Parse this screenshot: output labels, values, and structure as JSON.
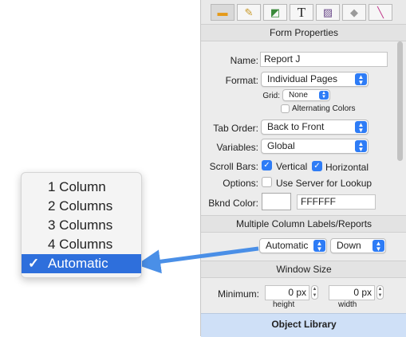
{
  "toolbar": {
    "tools": [
      {
        "icon": "field-tool-icon",
        "glyph": "▬",
        "active": true
      },
      {
        "icon": "pencil-icon",
        "glyph": "✎"
      },
      {
        "icon": "shapes-icon",
        "glyph": "◩"
      },
      {
        "icon": "text-tool-icon",
        "glyph": "T"
      },
      {
        "icon": "picture-icon",
        "glyph": "▨"
      },
      {
        "icon": "diamond-icon",
        "glyph": "◆"
      },
      {
        "icon": "line-tool-icon",
        "glyph": "╲"
      }
    ]
  },
  "form_properties": {
    "title": "Form Properties",
    "name_label": "Name:",
    "name_value": "Report J",
    "format_label": "Format:",
    "format_value": "Individual Pages",
    "grid_label": "Grid:",
    "grid_value": "None",
    "alternating_label": "Alternating Colors",
    "tab_order_label": "Tab Order:",
    "tab_order_value": "Back to Front",
    "variables_label": "Variables:",
    "variables_value": "Global",
    "scrollbars_label": "Scroll Bars:",
    "vertical_label": "Vertical",
    "horizontal_label": "Horizontal",
    "options_label": "Options:",
    "use_server_label": "Use Server for Lookup",
    "bknd_label": "Bknd Color:",
    "bknd_value": "FFFFFF"
  },
  "multi_column": {
    "title": "Multiple Column Labels/Reports",
    "columns_value": "Automatic",
    "direction_value": "Down"
  },
  "window_size": {
    "title": "Window Size",
    "minimum_label": "Minimum:",
    "height_value": "0 px",
    "width_value": "0 px",
    "height_caption": "height",
    "width_caption": "width"
  },
  "object_library": "Object Library",
  "columns_menu": {
    "items": [
      "1 Column",
      "2 Columns",
      "3 Columns",
      "4 Columns",
      "Automatic"
    ],
    "selected": "Automatic",
    "check": "✓"
  },
  "colors": {
    "accent": "#2e7cf6",
    "menu_selection": "#2e6fdc",
    "arrow": "#4a8fe7",
    "object_library_bg": "#cfe0f7"
  }
}
